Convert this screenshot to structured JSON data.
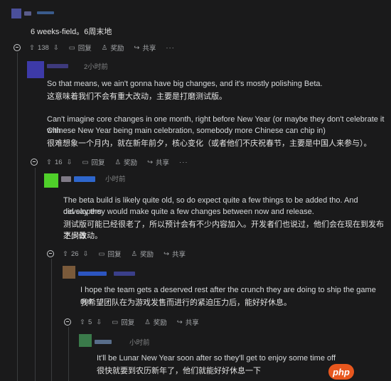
{
  "comments": [
    {
      "id": "c0",
      "body": [
        "6 weeks-field。6周末地"
      ],
      "actions": {
        "score": "138",
        "reply": "回复",
        "award": "奖励",
        "share": "共享",
        "more": "···"
      }
    },
    {
      "id": "c1",
      "timestamp": "2小时前",
      "body": [
        "So that means, we ain't gonna have big changes, and it's mostly polishing Beta.",
        "这意味着我们不会有重大改动，主要是打磨测试版。",
        "Can't imagine core changes in one month, right before New Year (or maybe they don't celebrate it with",
        "Chinese New Year being main celebration, somebody more Chinese can chip in)",
        "很难想象一个月内，就在新年前夕，核心变化（或者他们不庆祝春节，主要是中国人来参与）。"
      ],
      "actions": {
        "score": "16",
        "reply": "回复",
        "award": "奖励",
        "share": "共享",
        "more": "···"
      }
    },
    {
      "id": "c2",
      "timestamp": "小时前",
      "body": [
        "The beta build is likely quite old, so do expect quite a few things to be added tho. And developers",
        "did say they would make quite a few changes between now and release.",
        "测试版可能已经很老了，所以预计会有不少内容加入。开发者们也说过，他们会在现在到发布之间做",
        "不少改动。"
      ],
      "actions": {
        "score": "26",
        "reply": "回复",
        "award": "奖励",
        "share": "共享"
      }
    },
    {
      "id": "c3",
      "body": [
        "I hope the team gets a deserved rest after the crunch they are doing to ship the game out.",
        "我希望团队在为游戏发售而进行的紧迫压力后，能好好休息。"
      ],
      "actions": {
        "score": "5",
        "reply": "回复",
        "award": "奖励",
        "share": "共享"
      }
    },
    {
      "id": "c4",
      "timestamp": "小时前",
      "body": [
        "It'll be Lunar New Year soon after so they'll get to enjoy some time off",
        "很快就要到农历新年了，他们就能好好休息一下"
      ]
    }
  ],
  "watermark": "php",
  "colors": {
    "background": "#1a1a1b",
    "text": "#d7dadc",
    "muted": "#818384",
    "watermark": "#e8571e"
  }
}
